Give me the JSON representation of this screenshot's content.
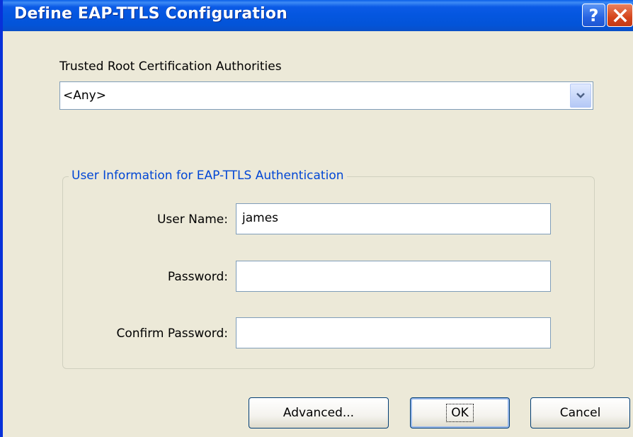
{
  "window": {
    "title": "Define EAP-TTLS Configuration",
    "help_label": "?"
  },
  "trusted_root": {
    "label": "Trusted Root Certification Authorities",
    "selected": "<Any>"
  },
  "user_info": {
    "legend": "User Information for EAP-TTLS Authentication",
    "username_label": "User Name:",
    "username_value": "james",
    "password_label": "Password:",
    "password_value": "",
    "confirm_label": "Confirm Password:",
    "confirm_value": ""
  },
  "buttons": {
    "advanced": "Advanced...",
    "ok": "OK",
    "cancel": "Cancel"
  },
  "colors": {
    "titlebar": "#0454df",
    "face": "#ece9d8",
    "legend": "#0046d5",
    "close": "#d5451b"
  }
}
